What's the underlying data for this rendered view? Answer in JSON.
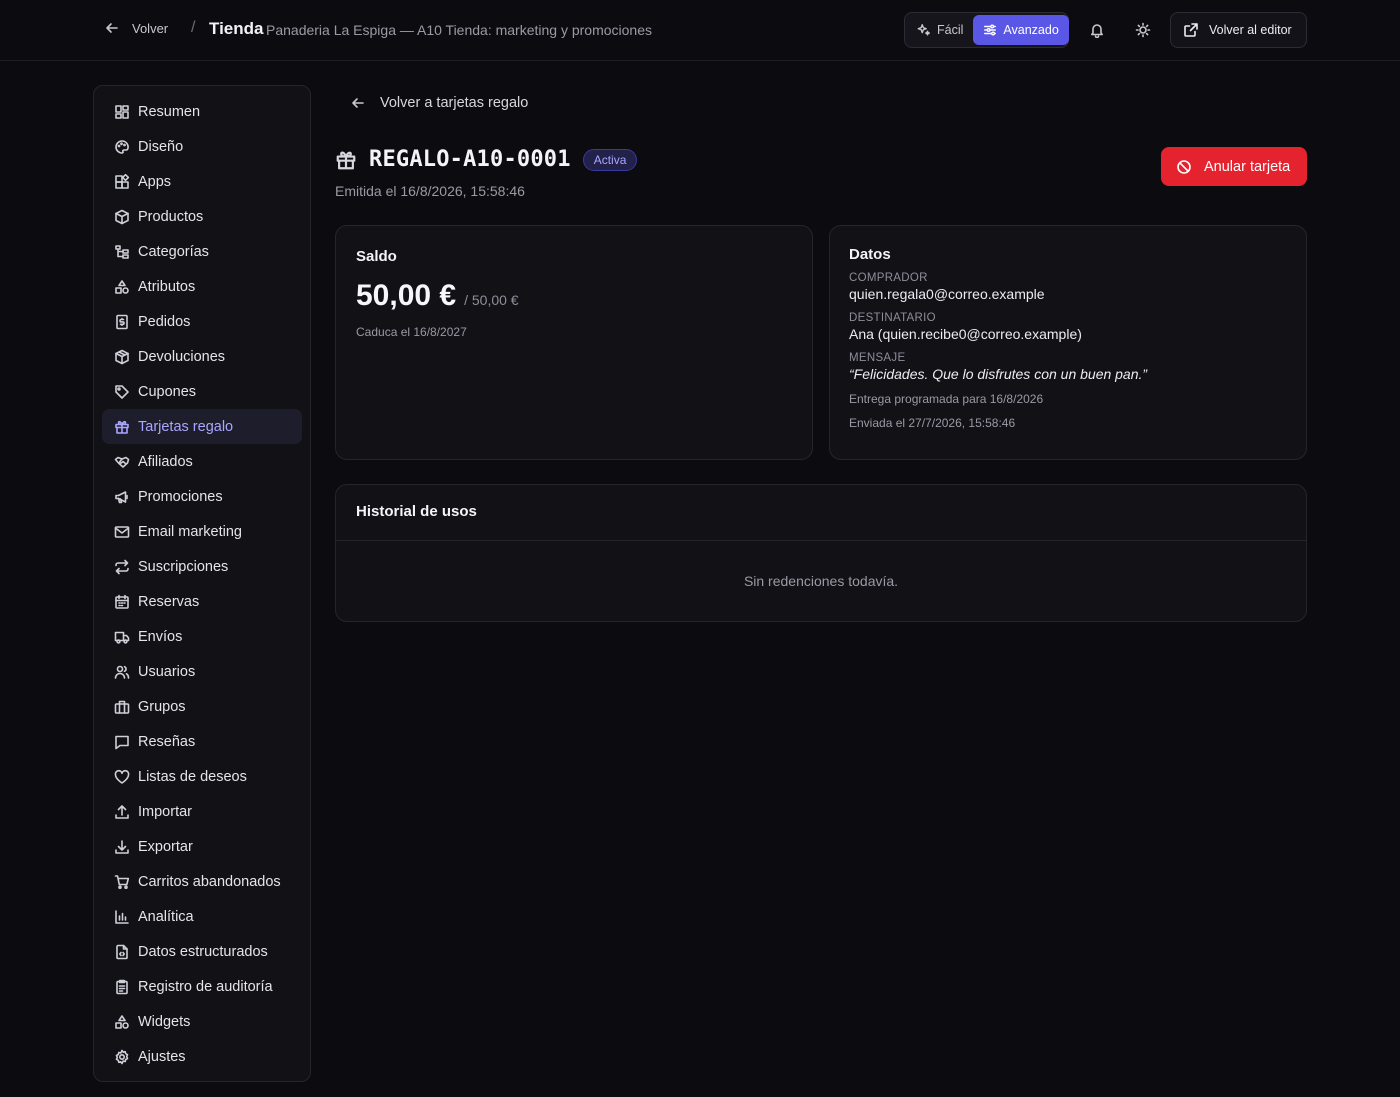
{
  "header": {
    "back_label": "Volver",
    "separator": "/",
    "section_title": "Tienda",
    "subtitle": "Panaderia La Espiga — A10 Tienda: marketing y promociones",
    "mode_easy": "Fácil",
    "mode_advanced": "Avanzado",
    "active_mode": "Avanzado",
    "editor_button": "Volver al editor",
    "bell_icon": "bell-icon",
    "theme_icon": "sun-icon"
  },
  "sidebar": {
    "items": [
      {
        "label": "Resumen",
        "icon": "dashboard-icon"
      },
      {
        "label": "Diseño",
        "icon": "palette-icon"
      },
      {
        "label": "Apps",
        "icon": "apps-icon"
      },
      {
        "label": "Productos",
        "icon": "box-icon"
      },
      {
        "label": "Categorías",
        "icon": "tree-icon"
      },
      {
        "label": "Atributos",
        "icon": "shapes-icon"
      },
      {
        "label": "Pedidos",
        "icon": "receipt-icon"
      },
      {
        "label": "Devoluciones",
        "icon": "box-return-icon"
      },
      {
        "label": "Cupones",
        "icon": "tag-icon"
      },
      {
        "label": "Tarjetas regalo",
        "icon": "gift-icon",
        "active": true
      },
      {
        "label": "Afiliados",
        "icon": "handshake-icon"
      },
      {
        "label": "Promociones",
        "icon": "megaphone-icon"
      },
      {
        "label": "Email marketing",
        "icon": "mail-icon"
      },
      {
        "label": "Suscripciones",
        "icon": "repeat-icon"
      },
      {
        "label": "Reservas",
        "icon": "calendar-icon"
      },
      {
        "label": "Envíos",
        "icon": "truck-icon"
      },
      {
        "label": "Usuarios",
        "icon": "users-icon"
      },
      {
        "label": "Grupos",
        "icon": "groups-icon"
      },
      {
        "label": "Reseñas",
        "icon": "message-icon"
      },
      {
        "label": "Listas de deseos",
        "icon": "heart-icon"
      },
      {
        "label": "Importar",
        "icon": "upload-icon"
      },
      {
        "label": "Exportar",
        "icon": "download-icon"
      },
      {
        "label": "Carritos abandonados",
        "icon": "cart-icon"
      },
      {
        "label": "Analítica",
        "icon": "bar-chart-icon"
      },
      {
        "label": "Datos estructurados",
        "icon": "file-code-icon"
      },
      {
        "label": "Registro de auditoría",
        "icon": "clipboard-icon"
      },
      {
        "label": "Widgets",
        "icon": "shapes-icon"
      },
      {
        "label": "Ajustes",
        "icon": "gear-icon"
      }
    ]
  },
  "main": {
    "back_label": "Volver a tarjetas regalo",
    "card_code": "REGALO-A10-0001",
    "status_badge": "Activa",
    "issued": "Emitida el 16/8/2026, 15:58:46",
    "void_button": "Anular tarjeta",
    "balance": {
      "heading": "Saldo",
      "value": "50,00 €",
      "of_total": "/ 50,00 €",
      "expires": "Caduca el 16/8/2027"
    },
    "details": {
      "heading": "Datos",
      "buyer_label": "COMPRADOR",
      "buyer": "quien.regala0@correo.example",
      "recipient_label": "DESTINATARIO",
      "recipient": "Ana (quien.recibe0@correo.example)",
      "message_label": "MENSAJE",
      "message": "“Felicidades. Que lo disfrutes con un buen pan.”",
      "scheduled": "Entrega programada para 16/8/2026",
      "sent": "Enviada el 27/7/2026, 15:58:46"
    },
    "history": {
      "heading": "Historial de usos",
      "empty": "Sin redenciones todavía."
    }
  },
  "colors": {
    "background": "#0c0c10",
    "accent": "#5b57e6",
    "danger": "#e5232f",
    "active_nav_text": "#a9a6ff"
  }
}
